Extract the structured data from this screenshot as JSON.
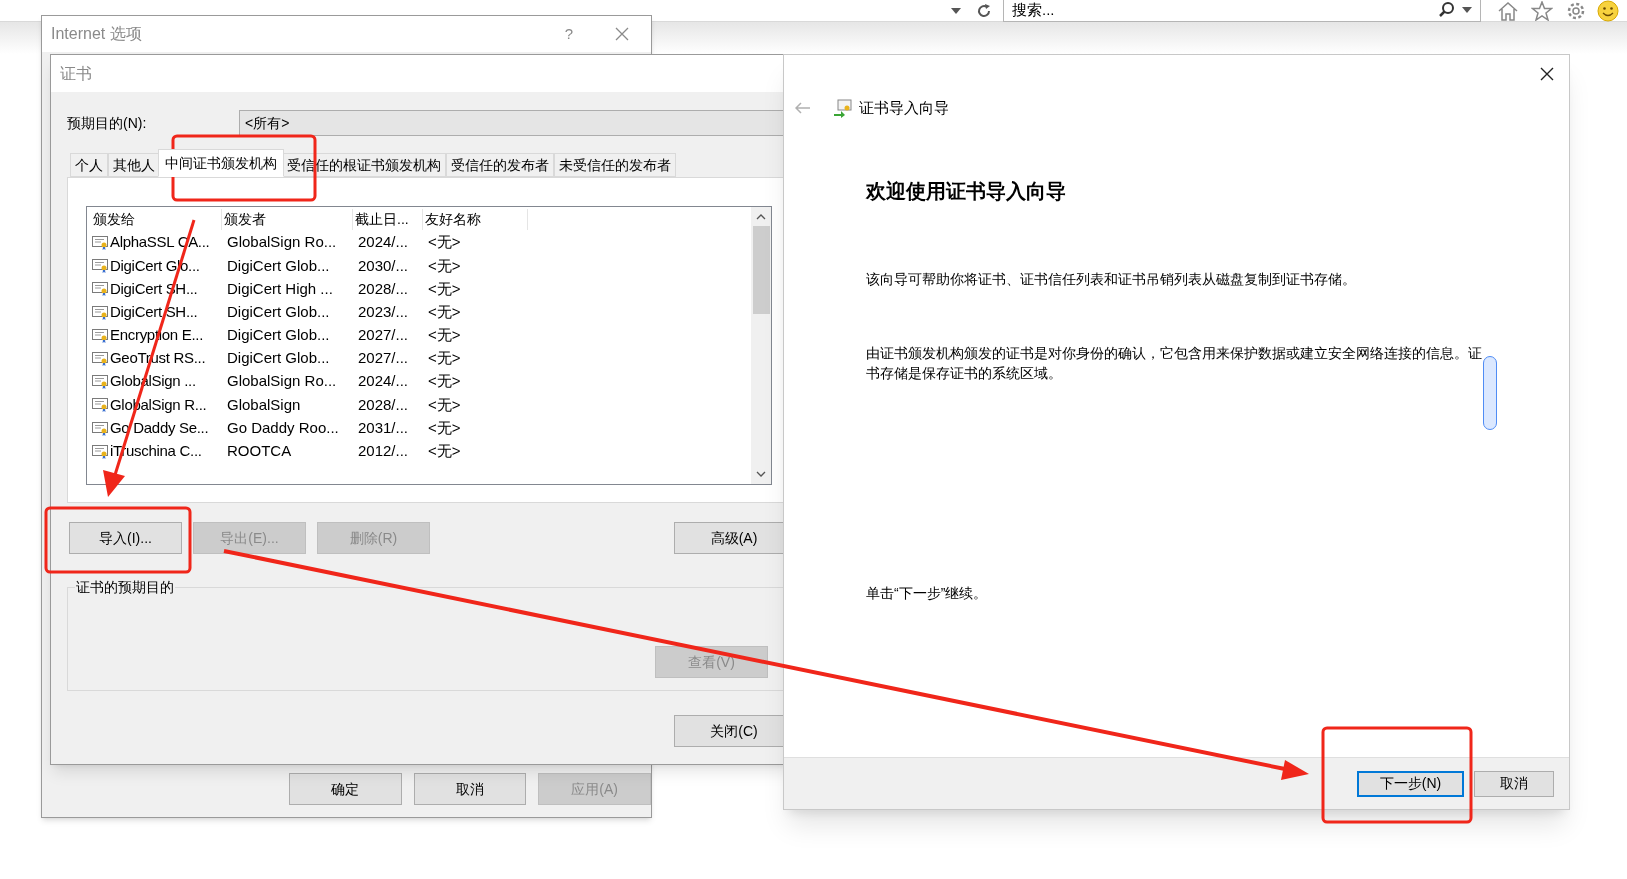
{
  "browser_bar": {
    "search": {
      "placeholder": "搜索..."
    }
  },
  "internet_options": {
    "title": "Internet 选项",
    "help_glyph": "?",
    "buttons": [
      {
        "label": "确定",
        "disabled": false
      },
      {
        "label": "取消",
        "disabled": false
      },
      {
        "label": "应用(A)",
        "disabled": true
      }
    ]
  },
  "cert_dialog": {
    "title": "证书",
    "purpose_label": "预期目的(N):",
    "purpose_value": "<所有>",
    "tabs": [
      {
        "label": "个人",
        "selected": false
      },
      {
        "label": "其他人",
        "selected": false
      },
      {
        "label": "中间证书颁发机构",
        "selected": true
      },
      {
        "label": "受信任的根证书颁发机构",
        "selected": false
      },
      {
        "label": "受信任的发布者",
        "selected": false
      },
      {
        "label": "未受信任的发布者",
        "selected": false
      }
    ],
    "columns": [
      "颁发给",
      "颁发者",
      "截止日...",
      "友好名称"
    ],
    "rows": [
      [
        "AlphaSSL CA...",
        "GlobalSign Ro...",
        "2024/...",
        "<无>"
      ],
      [
        "DigiCert Glo...",
        "DigiCert Glob...",
        "2030/...",
        "<无>"
      ],
      [
        "DigiCert SH...",
        "DigiCert High ...",
        "2028/...",
        "<无>"
      ],
      [
        "DigiCert SH...",
        "DigiCert Glob...",
        "2023/...",
        "<无>"
      ],
      [
        "Encryption E...",
        "DigiCert Glob...",
        "2027/...",
        "<无>"
      ],
      [
        "GeoTrust RS...",
        "DigiCert Glob...",
        "2027/...",
        "<无>"
      ],
      [
        "GlobalSign ...",
        "GlobalSign Ro...",
        "2024/...",
        "<无>"
      ],
      [
        "GlobalSign R...",
        "GlobalSign",
        "2028/...",
        "<无>"
      ],
      [
        "Go Daddy Se...",
        "Go Daddy Roo...",
        "2031/...",
        "<无>"
      ],
      [
        "iTruschina C...",
        "ROOTCA",
        "2012/...",
        "<无>"
      ]
    ],
    "buttons": [
      {
        "label": "导入(I)...",
        "disabled": false
      },
      {
        "label": "导出(E)...",
        "disabled": true
      },
      {
        "label": "删除(R)",
        "disabled": true
      }
    ],
    "advanced_button": {
      "label": "高级(A)",
      "disabled": false
    },
    "group_label": "证书的预期目的",
    "view_button": {
      "label": "查看(V)",
      "disabled": true
    },
    "close_button": {
      "label": "关闭(C)",
      "disabled": false
    }
  },
  "wizard": {
    "title": "证书导入向导",
    "heading": "欢迎使用证书导入向导",
    "paragraphs": [
      "该向导可帮助你将证书、证书信任列表和证书吊销列表从磁盘复制到证书存储。",
      "由证书颁发机构颁发的证书是对你身份的确认，它包含用来保护数据或建立安全网络连接的信息。证书存储是保存证书的系统区域。"
    ],
    "footer_note": "单击“下一步”继续。",
    "buttons": [
      {
        "label": "下一步(N)",
        "default": true
      },
      {
        "label": "取消",
        "default": false
      }
    ]
  }
}
